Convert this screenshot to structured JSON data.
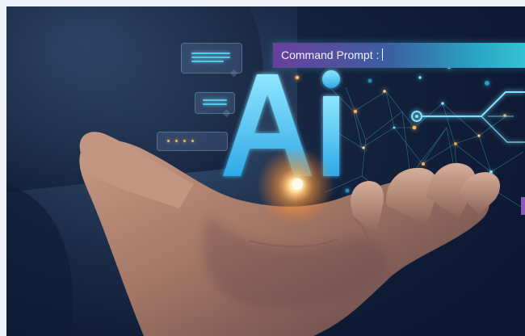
{
  "command_prompt": {
    "label": "Command Prompt :"
  },
  "logo_text": "Ai",
  "colors": {
    "page_background": "#eef0f7",
    "scene_background": "#1a2b47",
    "glow_cyan": "#3fc6ef",
    "glow_orange": "#ffb054",
    "prompt_gradient_start": "#6a3f9e",
    "prompt_gradient_end": "#34c6d6",
    "skin_tone": "#a97f6c"
  },
  "icons": [
    "chat-bubble-icon",
    "chat-bubble-icon",
    "chat-bubble-icon",
    "circuit-node-icon"
  ]
}
